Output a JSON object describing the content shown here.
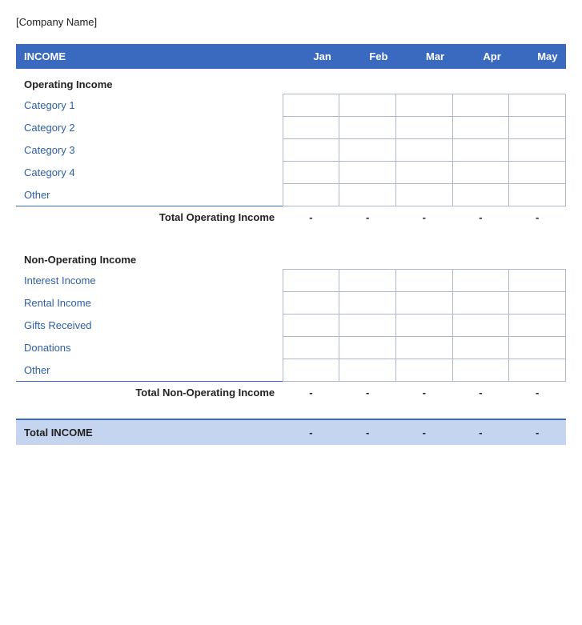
{
  "company": {
    "name": "[Company Name]"
  },
  "header": {
    "income_label": "INCOME",
    "months": [
      "Jan",
      "Feb",
      "Mar",
      "Apr",
      "May"
    ]
  },
  "operating_income": {
    "section_label": "Operating Income",
    "categories": [
      "Category 1",
      "Category 2",
      "Category 3",
      "Category 4",
      "Other"
    ],
    "total_label": "Total Operating Income",
    "total_values": [
      "-",
      "-",
      "-",
      "-",
      "-"
    ]
  },
  "non_operating_income": {
    "section_label": "Non-Operating Income",
    "categories": [
      "Interest Income",
      "Rental Income",
      "Gifts Received",
      "Donations",
      "Other"
    ],
    "total_label": "Total Non-Operating Income",
    "total_values": [
      "-",
      "-",
      "-",
      "-",
      "-"
    ]
  },
  "grand_total": {
    "label": "Total INCOME",
    "values": [
      "-",
      "-",
      "-",
      "-",
      "-"
    ]
  }
}
